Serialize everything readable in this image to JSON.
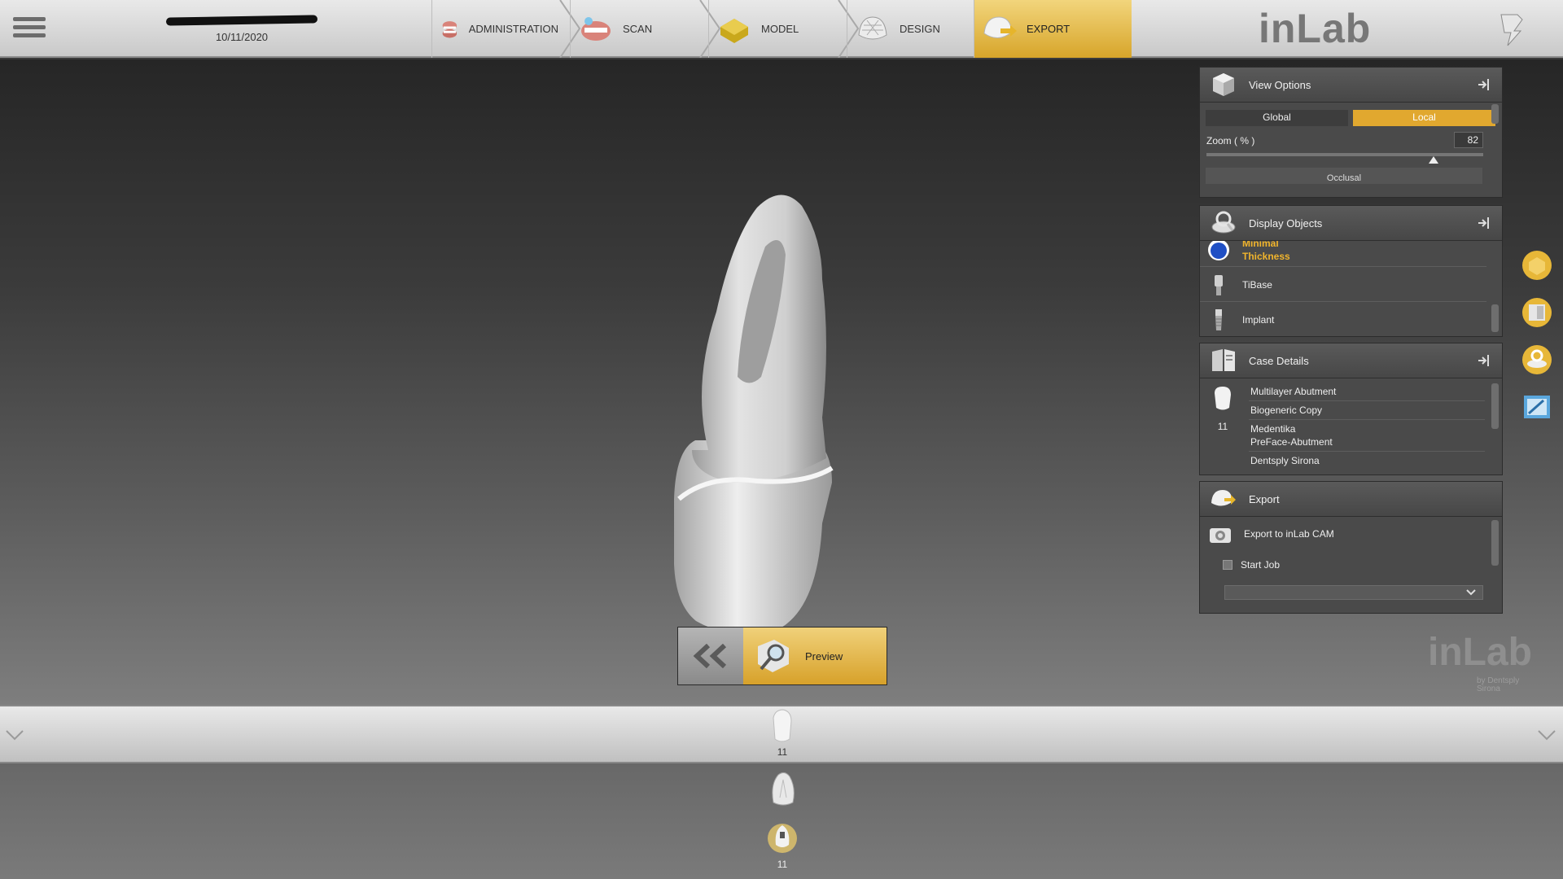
{
  "header": {
    "date": "10/11/2020",
    "steps": [
      {
        "label": "ADMINISTRATION"
      },
      {
        "label": "SCAN"
      },
      {
        "label": "MODEL"
      },
      {
        "label": "DESIGN"
      },
      {
        "label": "EXPORT"
      }
    ],
    "logo": "inLab"
  },
  "view_options": {
    "title": "View Options",
    "segments": [
      "Global",
      "Local"
    ],
    "active_segment": "Local",
    "zoom_label": "Zoom ( % )",
    "zoom_value": "82",
    "zoom_fraction": 0.82,
    "next_label": "Occlusal"
  },
  "display_objects": {
    "title": "Display Objects",
    "items": [
      {
        "label": "Minimal\nThickness",
        "selected": true
      },
      {
        "label": "TiBase"
      },
      {
        "label": "Implant"
      }
    ]
  },
  "case_details": {
    "title": "Case Details",
    "tooth": "11",
    "rows": [
      "Multilayer Abutment",
      "Biogeneric Copy",
      "Medentika\nPreFace-Abutment",
      "Dentsply Sirona"
    ]
  },
  "export_panel": {
    "title": "Export",
    "action": "Export to inLab CAM",
    "start_job": "Start Job"
  },
  "preview_label": "Preview",
  "strip_tooth": "11",
  "bottom_tooth": "11",
  "watermark": {
    "logo": "inLab",
    "by": "by",
    "brand": "Dentsply\nSirona"
  },
  "colors": {
    "accent": "#e1a82f",
    "panel": "#4a4a4a",
    "selected_text": "#f0b42c"
  }
}
